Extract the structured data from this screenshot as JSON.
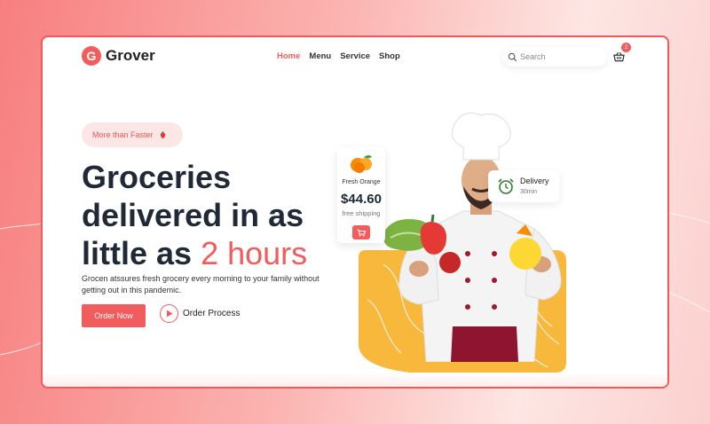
{
  "brand": {
    "logo_letter": "G",
    "name": "Grover"
  },
  "nav": {
    "items": [
      {
        "label": "Home",
        "active": true
      },
      {
        "label": "Menu",
        "active": false
      },
      {
        "label": "Service",
        "active": false
      },
      {
        "label": "Shop",
        "active": false
      }
    ]
  },
  "search": {
    "placeholder": "Search",
    "value": ""
  },
  "cart": {
    "icon": "basket-icon",
    "count": "2"
  },
  "hero": {
    "pill_label": "More than Faster",
    "headline_line1": "Groceries",
    "headline_line2": "delivered in as",
    "headline_line3_prefix": "little as ",
    "headline_highlight": "2 hours",
    "description": "Grocen atssures fresh grocery every morning to your family without getting out in this pandemic.",
    "order_button": "Order Now",
    "process_label": "Order Process"
  },
  "product_card": {
    "name": "Fresh Orange",
    "price": "$44.60",
    "shipping": "free shipping",
    "icon": "orange-fruit-icon",
    "cart_icon": "cart-icon"
  },
  "delivery_card": {
    "title": "Delivery",
    "time": "30min",
    "icon": "alarm-clock-icon"
  },
  "colors": {
    "accent": "#f25c5c",
    "heading": "#1f2a36",
    "blob": "#f7b83b",
    "pill_bg": "#fde6e6"
  }
}
